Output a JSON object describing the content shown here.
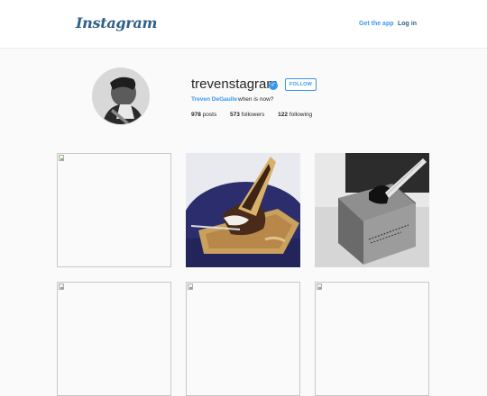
{
  "header": {
    "logo": "Instagram",
    "get_app": "Get the app",
    "login": "Log in"
  },
  "profile": {
    "username": "trevenstagram",
    "verified_icon": "verified-badge-icon",
    "follow": "FOLLOW",
    "full_name": "Treven DeGaulle",
    "bio": "when is now?",
    "stats": {
      "posts_count": "978",
      "posts_label": "posts",
      "followers_count": "573",
      "followers_label": "followers",
      "following_count": "122",
      "following_label": "following"
    }
  },
  "posts": [
    {
      "kind": "broken"
    },
    {
      "kind": "photo",
      "subject": "ice cream cone dessert"
    },
    {
      "kind": "photo",
      "subject": "black and white box with axe"
    },
    {
      "kind": "broken"
    },
    {
      "kind": "broken"
    },
    {
      "kind": "broken"
    }
  ],
  "colors": {
    "accent": "#3897f0",
    "logo": "#2f5f8a",
    "background": "#fafafa"
  }
}
